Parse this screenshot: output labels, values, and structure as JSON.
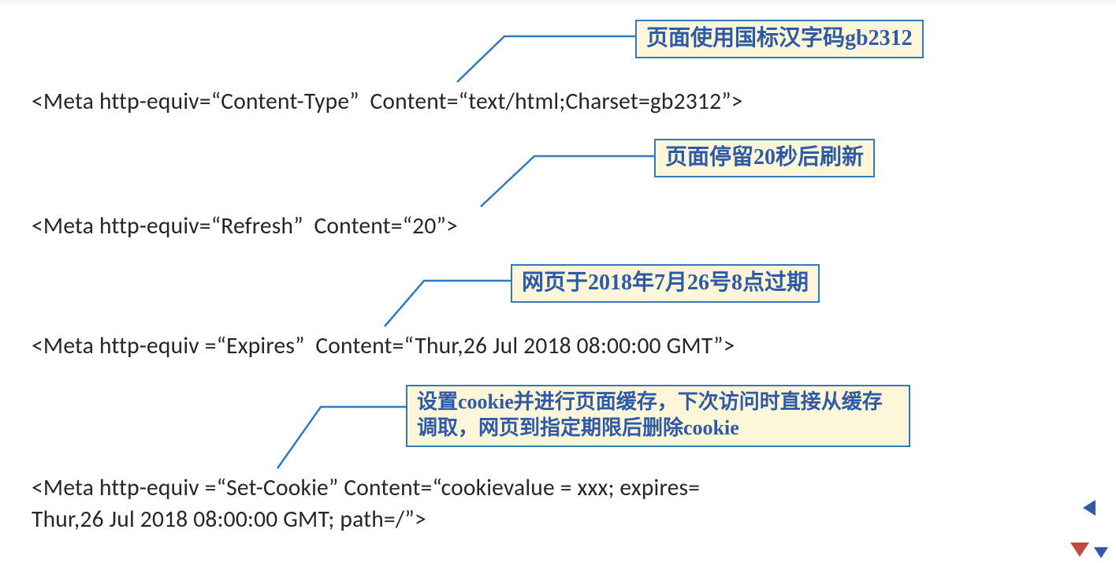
{
  "callouts": [
    {
      "text": "页面使用国标汉字码gb2312"
    },
    {
      "text": "页面停留20秒后刷新"
    },
    {
      "text": "网页于2018年7月26号8点过期"
    },
    {
      "text": "设置cookie并进行页面缓存，下次访问时直接从缓存调取，网页到指定期限后删除cookie"
    }
  ],
  "code": {
    "line1": "<Meta http-equiv=“Content-Type”  Content=“text/html;Charset=gb2312”>",
    "line2": "<Meta http-equiv=“Refresh”  Content=“20”>",
    "line3": "<Meta http-equiv =“Expires”  Content=“Thur,26 Jul 2018 08:00:00 GMT”>",
    "line4a": "<Meta http-equiv =“Set-Cookie” Content=“cookievalue = xxx; expires=",
    "line4b": "Thur,26 Jul 2018 08:00:00 GMT; path=/”>"
  }
}
